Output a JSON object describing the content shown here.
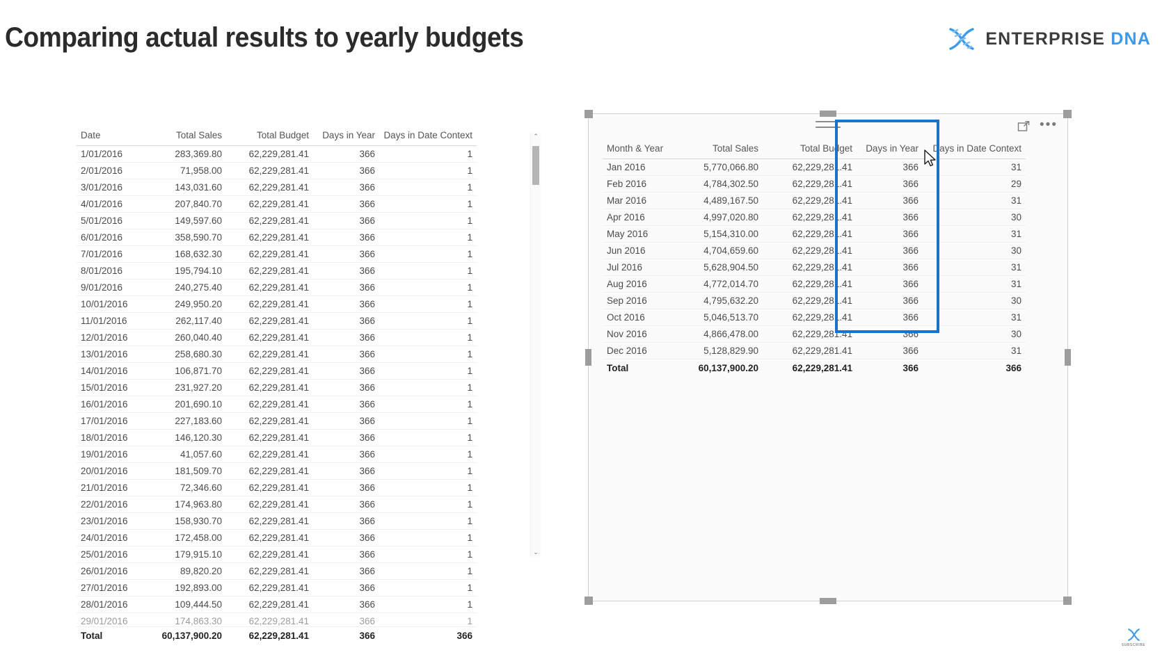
{
  "header": {
    "title": "Comparing actual results to yearly budgets",
    "brand": {
      "word1": "ENTERPRISE",
      "word2": "DNA",
      "icon": "dna-helix-icon",
      "accent_color": "#3c9ae8",
      "text_color": "#3c3c3c"
    }
  },
  "left_visual": {
    "name": "daily-date-table",
    "columns": [
      "Date",
      "Total Sales",
      "Total Budget",
      "Days in Year",
      "Days in Date Context"
    ],
    "rows": [
      [
        "1/01/2016",
        "283,369.80",
        "62,229,281.41",
        "366",
        "1"
      ],
      [
        "2/01/2016",
        "71,958.00",
        "62,229,281.41",
        "366",
        "1"
      ],
      [
        "3/01/2016",
        "143,031.60",
        "62,229,281.41",
        "366",
        "1"
      ],
      [
        "4/01/2016",
        "207,840.70",
        "62,229,281.41",
        "366",
        "1"
      ],
      [
        "5/01/2016",
        "149,597.60",
        "62,229,281.41",
        "366",
        "1"
      ],
      [
        "6/01/2016",
        "358,590.70",
        "62,229,281.41",
        "366",
        "1"
      ],
      [
        "7/01/2016",
        "168,632.30",
        "62,229,281.41",
        "366",
        "1"
      ],
      [
        "8/01/2016",
        "195,794.10",
        "62,229,281.41",
        "366",
        "1"
      ],
      [
        "9/01/2016",
        "240,275.40",
        "62,229,281.41",
        "366",
        "1"
      ],
      [
        "10/01/2016",
        "249,950.20",
        "62,229,281.41",
        "366",
        "1"
      ],
      [
        "11/01/2016",
        "262,117.40",
        "62,229,281.41",
        "366",
        "1"
      ],
      [
        "12/01/2016",
        "260,040.40",
        "62,229,281.41",
        "366",
        "1"
      ],
      [
        "13/01/2016",
        "258,680.30",
        "62,229,281.41",
        "366",
        "1"
      ],
      [
        "14/01/2016",
        "106,871.70",
        "62,229,281.41",
        "366",
        "1"
      ],
      [
        "15/01/2016",
        "231,927.20",
        "62,229,281.41",
        "366",
        "1"
      ],
      [
        "16/01/2016",
        "201,690.10",
        "62,229,281.41",
        "366",
        "1"
      ],
      [
        "17/01/2016",
        "227,183.60",
        "62,229,281.41",
        "366",
        "1"
      ],
      [
        "18/01/2016",
        "146,120.30",
        "62,229,281.41",
        "366",
        "1"
      ],
      [
        "19/01/2016",
        "41,057.60",
        "62,229,281.41",
        "366",
        "1"
      ],
      [
        "20/01/2016",
        "181,509.70",
        "62,229,281.41",
        "366",
        "1"
      ],
      [
        "21/01/2016",
        "72,346.60",
        "62,229,281.41",
        "366",
        "1"
      ],
      [
        "22/01/2016",
        "174,963.80",
        "62,229,281.41",
        "366",
        "1"
      ],
      [
        "23/01/2016",
        "158,930.70",
        "62,229,281.41",
        "366",
        "1"
      ],
      [
        "24/01/2016",
        "172,458.00",
        "62,229,281.41",
        "366",
        "1"
      ],
      [
        "25/01/2016",
        "179,915.10",
        "62,229,281.41",
        "366",
        "1"
      ],
      [
        "26/01/2016",
        "89,820.20",
        "62,229,281.41",
        "366",
        "1"
      ],
      [
        "27/01/2016",
        "192,893.00",
        "62,229,281.41",
        "366",
        "1"
      ],
      [
        "28/01/2016",
        "109,444.50",
        "62,229,281.41",
        "366",
        "1"
      ],
      [
        "29/01/2016",
        "174,863.30",
        "62,229,281.41",
        "366",
        "1"
      ]
    ],
    "total_row": [
      "Total",
      "60,137,900.20",
      "62,229,281.41",
      "366",
      "366"
    ],
    "scrollbar": {
      "up_arrow": "⌃",
      "down_arrow": "⌄"
    }
  },
  "right_visual": {
    "name": "month-year-table",
    "selected": true,
    "header_icons": [
      {
        "name": "focus-mode-icon",
        "label": "Focus mode"
      },
      {
        "name": "more-options-icon",
        "label": "•••"
      }
    ],
    "columns": [
      "Month & Year",
      "Total Sales",
      "Total Budget",
      "Days in Year",
      "Days in Date Context"
    ],
    "rows": [
      [
        "Jan 2016",
        "5,770,066.80",
        "62,229,281.41",
        "366",
        "31"
      ],
      [
        "Feb 2016",
        "4,784,302.50",
        "62,229,281.41",
        "366",
        "29"
      ],
      [
        "Mar 2016",
        "4,489,167.50",
        "62,229,281.41",
        "366",
        "31"
      ],
      [
        "Apr 2016",
        "4,997,020.80",
        "62,229,281.41",
        "366",
        "30"
      ],
      [
        "May 2016",
        "5,154,310.00",
        "62,229,281.41",
        "366",
        "31"
      ],
      [
        "Jun 2016",
        "4,704,659.60",
        "62,229,281.41",
        "366",
        "30"
      ],
      [
        "Jul 2016",
        "5,628,904.50",
        "62,229,281.41",
        "366",
        "31"
      ],
      [
        "Aug 2016",
        "4,772,014.70",
        "62,229,281.41",
        "366",
        "31"
      ],
      [
        "Sep 2016",
        "4,795,632.20",
        "62,229,281.41",
        "366",
        "30"
      ],
      [
        "Oct 2016",
        "5,046,513.70",
        "62,229,281.41",
        "366",
        "31"
      ],
      [
        "Nov 2016",
        "4,866,478.00",
        "62,229,281.41",
        "366",
        "30"
      ],
      [
        "Dec 2016",
        "5,128,829.90",
        "62,229,281.41",
        "366",
        "31"
      ]
    ],
    "total_row": [
      "Total",
      "60,137,900.20",
      "62,229,281.41",
      "366",
      "366"
    ],
    "highlight": {
      "name": "days-in-date-context-highlight",
      "color": "#1a73c8",
      "target_column": "Days in Date Context"
    }
  },
  "subscribe": {
    "label": "SUBSCRIBE",
    "icon": "dna-helix-icon"
  }
}
